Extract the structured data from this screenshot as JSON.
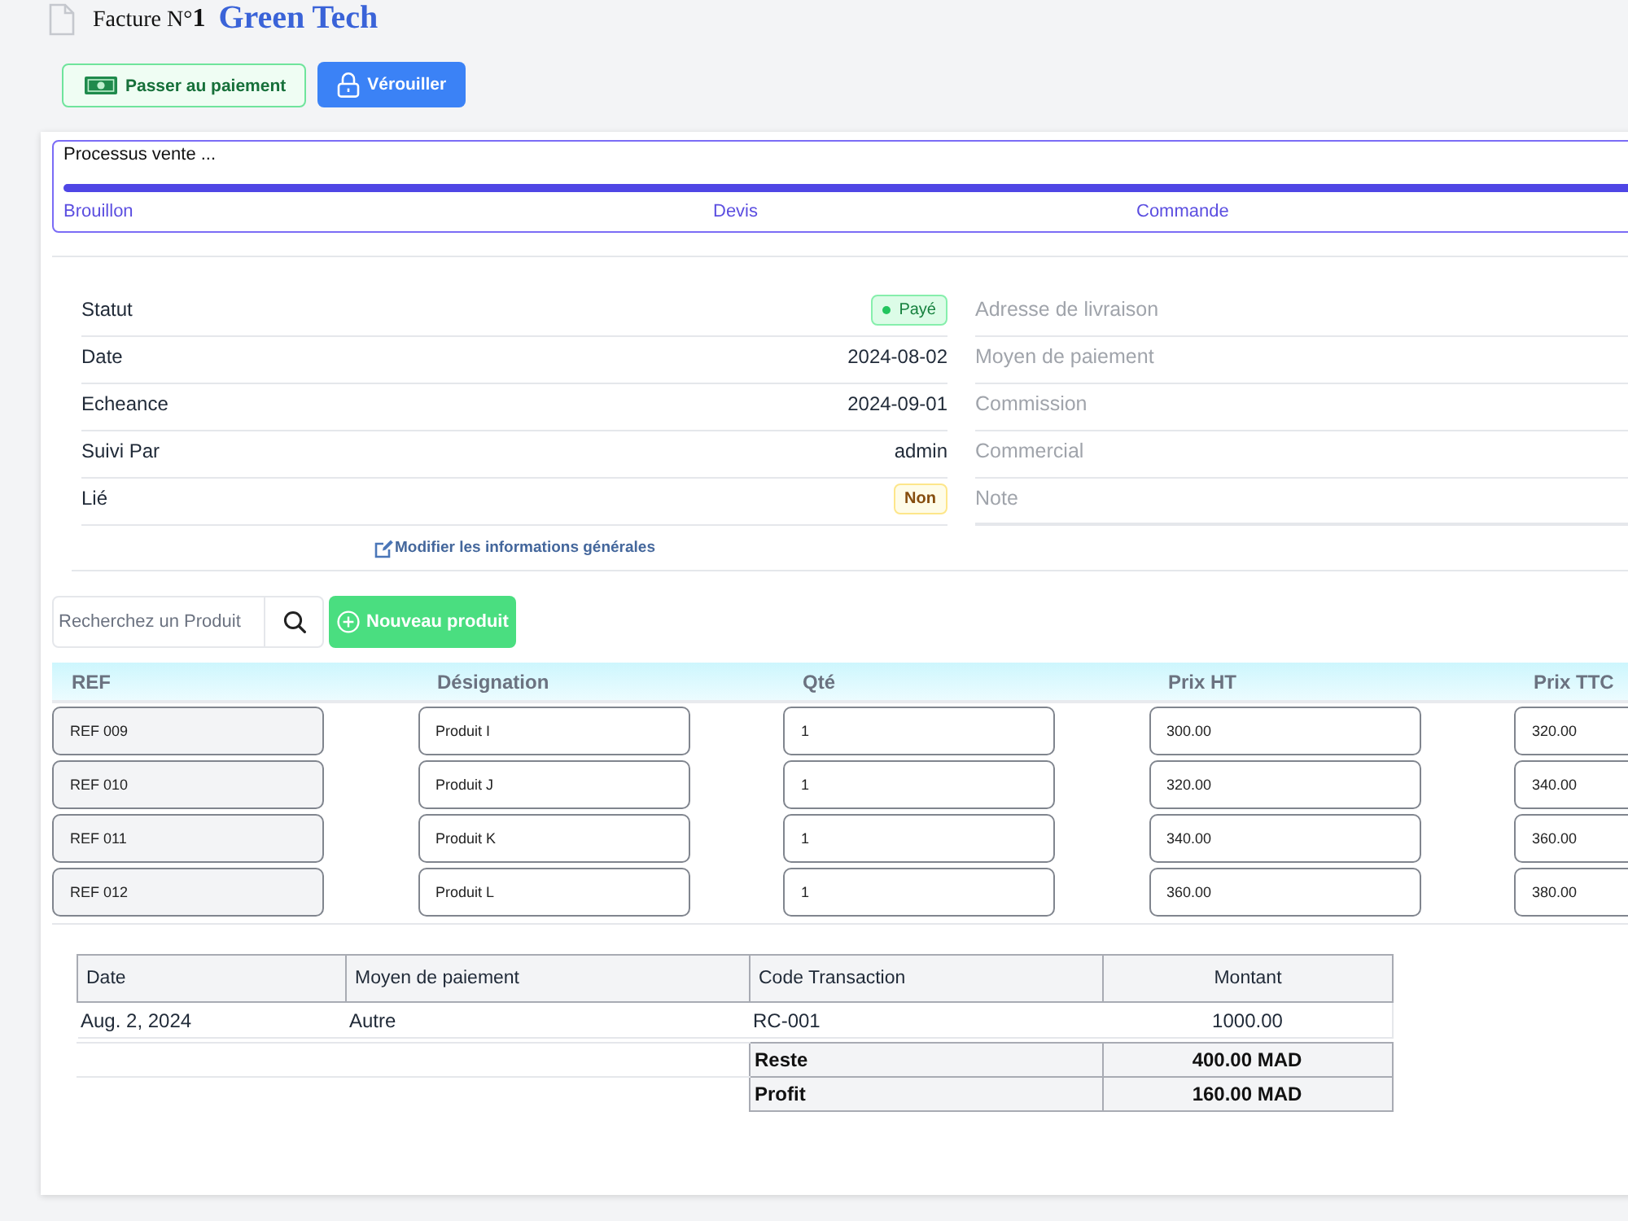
{
  "header": {
    "title": "Facture N°**1**",
    "client": "Green Tech"
  },
  "actions": [
    {
      "kind": "pay",
      "label": "Passer au paiement"
    },
    {
      "kind": "lock",
      "label": "Vérouiller"
    }
  ],
  "process": {
    "title": "Processus vente ...",
    "level": 1,
    "steps": [
      {
        "label": "Brouillon"
      },
      {
        "label": "Devis"
      },
      {
        "label": "Commande"
      }
    ]
  },
  "general_info": {
    "rows": [
      {
        "label": "Statut",
        "kind": "status",
        "value": "Payé"
      },
      {
        "label": "Date",
        "kind": "text",
        "value": "2024-08-02"
      },
      {
        "label": "Echeance",
        "kind": "text",
        "value": "2024-09-01"
      },
      {
        "label": "Suivi Par",
        "kind": "text",
        "value": "admin"
      },
      {
        "label": "Lié",
        "kind": "tag",
        "value": "Non"
      }
    ],
    "edit_link": "Modifier les informations générales"
  },
  "other_info": {
    "rows": [
      {
        "label": "Adresse de livraison"
      },
      {
        "label": "Moyen de paiement"
      },
      {
        "label": "Commission"
      },
      {
        "label": "Commercial"
      },
      {
        "label": "Note"
      }
    ]
  },
  "product_search": {
    "placeholder": "Recherchez un Produit"
  },
  "new_product_button": {
    "label": "Nouveau produit"
  },
  "products": {
    "columns": [
      {
        "label": "REF",
        "readonly": true
      },
      {
        "label": "Désignation",
        "readonly": false
      },
      {
        "label": "Qté",
        "readonly": false
      },
      {
        "label": "Prix HT",
        "readonly": false
      },
      {
        "label": "Prix TTC",
        "readonly": false
      }
    ],
    "rows": [
      {
        "cells": [
          "REF 009",
          "Produit I",
          "1",
          "300.00",
          "320.00"
        ]
      },
      {
        "cells": [
          "REF 010",
          "Produit J",
          "1",
          "320.00",
          "340.00"
        ]
      },
      {
        "cells": [
          "REF 011",
          "Produit K",
          "1",
          "340.00",
          "360.00"
        ]
      },
      {
        "cells": [
          "REF 012",
          "Produit L",
          "1",
          "360.00",
          "380.00"
        ]
      }
    ]
  },
  "payments": {
    "columns": [
      "Date",
      "Moyen de paiement",
      "Code Transaction",
      "Montant"
    ],
    "rows": [
      {
        "cells": [
          "Aug. 2, 2024",
          "Autre",
          "RC-001",
          "1000.00"
        ]
      }
    ],
    "totals": [
      {
        "label": "Reste",
        "value": "400.00 MAD"
      },
      {
        "label": "Profit",
        "value": "160.00 MAD"
      }
    ]
  }
}
